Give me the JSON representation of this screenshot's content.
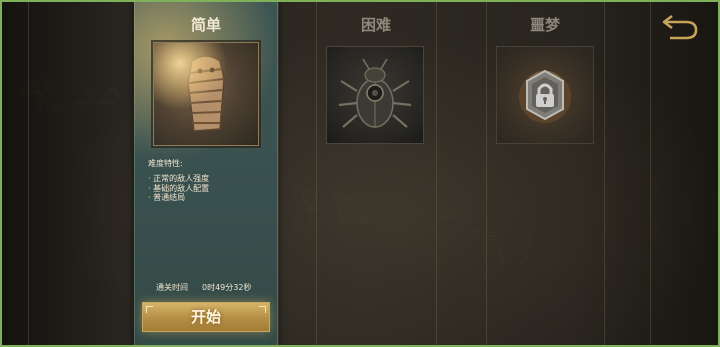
{
  "difficulties": [
    {
      "title": "简单",
      "selected": true
    },
    {
      "title": "困难",
      "selected": false
    },
    {
      "title": "噩梦",
      "selected": false,
      "locked": true
    }
  ],
  "details": {
    "heading": "难度特性:",
    "traits": [
      "· 正常的敌人强度",
      "· 基础的敌人配置",
      "· 普通结局"
    ],
    "clear_time_label": "通关时间",
    "clear_time_value": "0时49分32秒"
  },
  "start_button_label": "开始",
  "icons": {
    "back": "back-arrow-icon",
    "lock": "lock-icon",
    "scarab": "scarab-icon",
    "mummy": "mummy-icon"
  },
  "colors": {
    "frame_border": "#7fb05a",
    "selected_panel": "#3a5250",
    "gold_button": "#b48e44",
    "back_icon": "#c9a25a"
  }
}
